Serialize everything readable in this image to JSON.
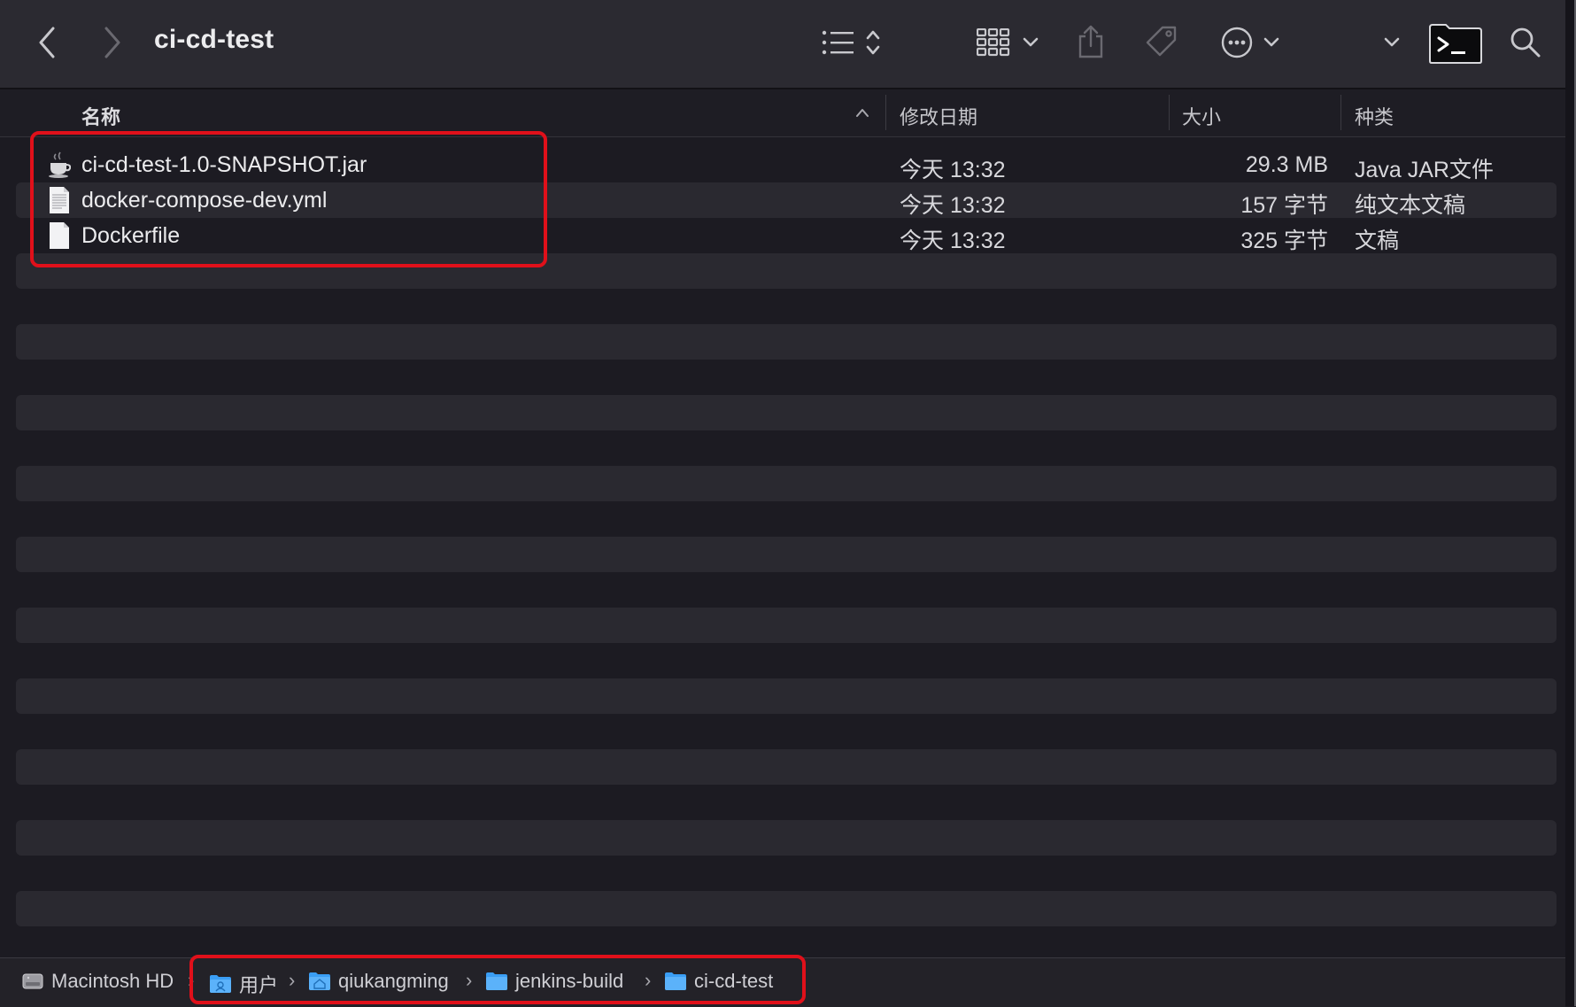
{
  "window": {
    "title": "ci-cd-test"
  },
  "toolbar": {
    "icons": [
      "chevron-left-icon",
      "chevron-right-icon",
      "list-view-icon",
      "sort-updown-icon",
      "grid-group-icon",
      "chevron-down-icon",
      "share-icon",
      "tag-icon",
      "more-ellipsis-icon",
      "chevron-down-icon",
      "chevron-down-icon",
      "terminal-icon",
      "search-icon"
    ]
  },
  "columns": {
    "name": "名称",
    "date": "修改日期",
    "size": "大小",
    "kind": "种类"
  },
  "files": [
    {
      "name": "ci-cd-test-1.0-SNAPSHOT.jar",
      "date": "今天 13:32",
      "size": "29.3 MB",
      "kind": "Java JAR文件",
      "icon": "java-jar-icon"
    },
    {
      "name": "docker-compose-dev.yml",
      "date": "今天 13:32",
      "size": "157 字节",
      "kind": "纯文本文稿",
      "icon": "text-document-icon"
    },
    {
      "name": "Dockerfile",
      "date": "今天 13:32",
      "size": "325 字节",
      "kind": "文稿",
      "icon": "blank-document-icon"
    }
  ],
  "pathbar": {
    "items": [
      {
        "label": "Macintosh HD",
        "icon": "hard-drive-icon"
      },
      {
        "label": "用户",
        "icon": "users-folder-icon"
      },
      {
        "label": "qiukangming",
        "icon": "home-folder-icon"
      },
      {
        "label": "jenkins-build",
        "icon": "folder-icon"
      },
      {
        "label": "ci-cd-test",
        "icon": "folder-icon"
      }
    ],
    "separator": "›"
  },
  "colors": {
    "highlight": "#e0101a",
    "folder": "#3a9ef5"
  }
}
